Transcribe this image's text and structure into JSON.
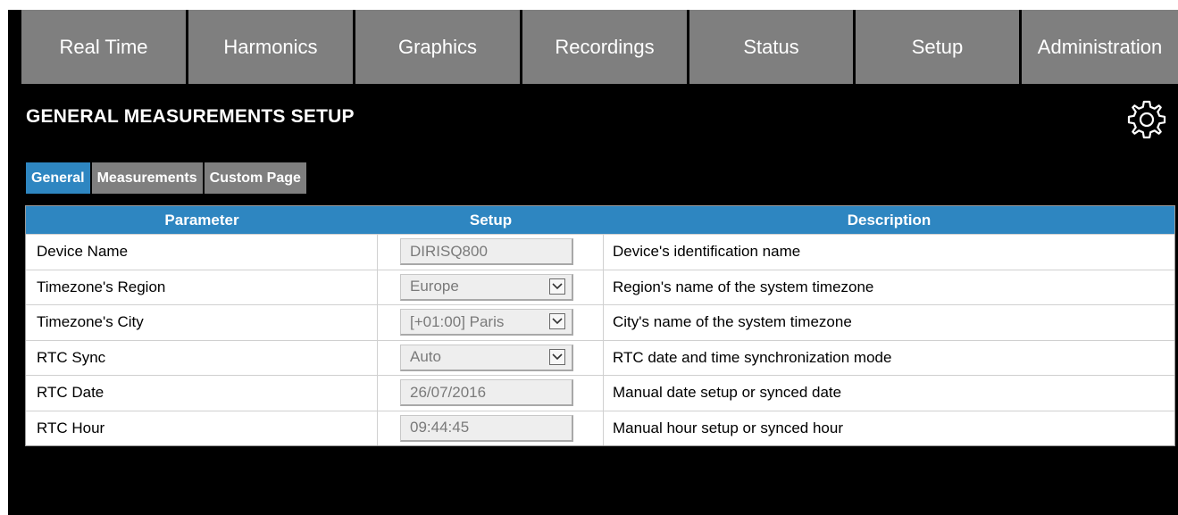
{
  "nav": {
    "items": [
      {
        "label": "Real Time"
      },
      {
        "label": "Harmonics"
      },
      {
        "label": "Graphics"
      },
      {
        "label": "Recordings"
      },
      {
        "label": "Status"
      },
      {
        "label": "Setup"
      },
      {
        "label": "Administration"
      }
    ]
  },
  "page": {
    "title": "GENERAL MEASUREMENTS SETUP",
    "settings_icon": "gear-icon"
  },
  "tabs": [
    {
      "label": "General",
      "active": true
    },
    {
      "label": "Measurements",
      "active": false
    },
    {
      "label": "Custom Page",
      "active": false
    }
  ],
  "table": {
    "headers": {
      "parameter": "Parameter",
      "setup": "Setup",
      "description": "Description"
    },
    "rows": [
      {
        "parameter": "Device Name",
        "value": "DIRISQ800",
        "type": "text",
        "description": "Device's identification name"
      },
      {
        "parameter": "Timezone's Region",
        "value": "Europe",
        "type": "select",
        "description": "Region's name of the system timezone"
      },
      {
        "parameter": "Timezone's City",
        "value": "[+01:00] Paris",
        "type": "select",
        "description": "City's name of the system timezone"
      },
      {
        "parameter": "RTC Sync",
        "value": "Auto",
        "type": "select",
        "description": "RTC date and time synchronization mode"
      },
      {
        "parameter": "RTC Date",
        "value": "26/07/2016",
        "type": "text",
        "description": "Manual date setup or synced date"
      },
      {
        "parameter": "RTC Hour",
        "value": "09:44:45",
        "type": "text",
        "description": "Manual hour setup or synced hour"
      }
    ]
  },
  "colors": {
    "accent": "#2e86c1",
    "nav_bg": "#7f7f7f",
    "page_bg": "#000000"
  }
}
